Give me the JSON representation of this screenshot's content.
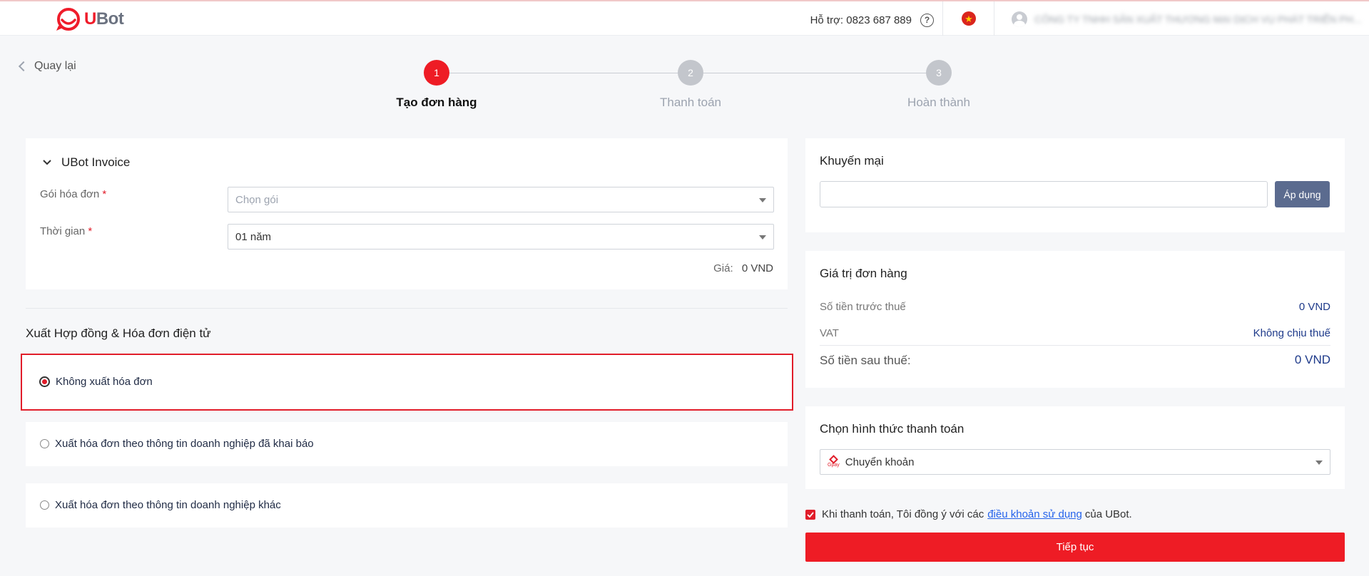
{
  "header": {
    "logo_text": "UBot",
    "support_text": "Hỗ trợ: 0823 687 889",
    "user_name": "CÔNG TY TNHH SẢN XUẤT THƯƠNG MẠI DỊCH VỤ PHÁT TRIỂN PH..."
  },
  "nav": {
    "back_label": "Quay lại"
  },
  "steps": [
    {
      "number": "1",
      "label": "Tạo đơn hàng",
      "active": true
    },
    {
      "number": "2",
      "label": "Thanh toán",
      "active": false
    },
    {
      "number": "3",
      "label": "Hoàn thành",
      "active": false
    }
  ],
  "product": {
    "title": "UBot Invoice",
    "package_label": "Gói hóa đơn",
    "package_placeholder": "Chọn gói",
    "duration_label": "Thời gian",
    "duration_value": "01 năm",
    "price_label": "Giá:",
    "price_value": "0 VND",
    "required_mark": "*"
  },
  "invoice_export": {
    "title": "Xuất Hợp đồng & Hóa đơn điện tử",
    "options": [
      {
        "label": "Không xuất hóa đơn",
        "selected": true
      },
      {
        "label": "Xuất hóa đơn theo thông tin doanh nghiệp đã khai báo",
        "selected": false
      },
      {
        "label": "Xuất hóa đơn theo thông tin doanh nghiệp khác",
        "selected": false
      }
    ]
  },
  "promo": {
    "title": "Khuyến mại",
    "input_value": "",
    "apply_label": "Áp dụng"
  },
  "order_value": {
    "title": "Giá trị đơn hàng",
    "pre_tax_label": "Số tiền trước thuế",
    "pre_tax_value": "0 VND",
    "vat_label": "VAT",
    "vat_value": "Không chịu thuế",
    "post_tax_label": "Số tiền sau thuế:",
    "post_tax_value": "0 VND"
  },
  "payment": {
    "title": "Chọn hình thức thanh toán",
    "method_icon_text": "Gpay",
    "method_value": "Chuyển khoản"
  },
  "terms": {
    "prefix": "Khi thanh toán, Tôi đồng ý với các",
    "link": "điều khoản sử dụng",
    "suffix": "của UBot.",
    "checked": true
  },
  "submit_label": "Tiếp tục",
  "colors": {
    "brand_red": "#ee1c25",
    "apply_button": "#5b6b8f",
    "highlight_border": "#e11d2a",
    "link_blue": "#2563eb",
    "value_navy": "#1e3a8a"
  }
}
